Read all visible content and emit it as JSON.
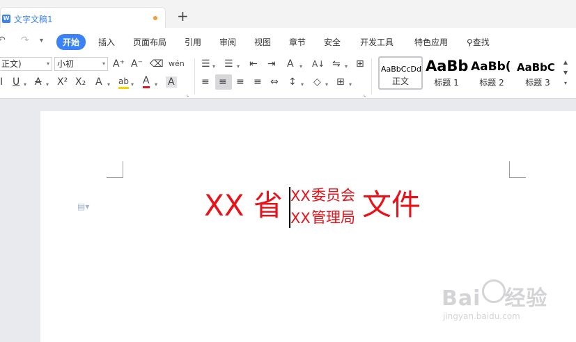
{
  "tabbar": {
    "doc_icon": "word-doc-icon",
    "doc_title": "文字文稿1",
    "new_tab": "+"
  },
  "menu": {
    "undo": "↶",
    "redo": "↷",
    "more": "▾",
    "items": [
      "开始",
      "插入",
      "页面布局",
      "引用",
      "审阅",
      "视图",
      "章节",
      "安全",
      "开发工具",
      "特色应用"
    ],
    "search_label": "查找",
    "accent_color": "#3b82f6"
  },
  "toolbar": {
    "font_name": "正文)",
    "font_size": "小初",
    "grow_font": "A⁺",
    "shrink_font": "A⁻",
    "clear_format": "⌫",
    "phonetic": "wén",
    "underline": "U",
    "strikethrough": "A",
    "superscript": "X²",
    "subscript": "X₂",
    "text_effect": "A",
    "highlight": "ab",
    "font_color": "A",
    "char_shading": "A",
    "bullets": "☰",
    "numbering": "☰",
    "decrease_indent": "⇤",
    "increase_indent": "⇥",
    "char_spacing": "A",
    "sort": "A↓",
    "tab_show": "⇋",
    "table": "⊞",
    "align_left": "≡",
    "align_center": "≡",
    "align_right": "≡",
    "justify": "≡",
    "distribute": "⇔",
    "line_spacing": "↕",
    "shading": "◇",
    "borders": "⊞",
    "dropdown": "▾"
  },
  "styles": {
    "items": [
      {
        "sample": "AaBbCcDd",
        "label": "正文"
      },
      {
        "sample": "AaBb",
        "label": "标题 1"
      },
      {
        "sample": "AaBb(",
        "label": "标题 2"
      },
      {
        "sample": "AaBbC",
        "label": "标题 3"
      }
    ],
    "scroll_up": "▲",
    "scroll_down": "▼",
    "more": "▾"
  },
  "document": {
    "province": "XX 省",
    "line1_xx": "XX",
    "line1_org": "委员会",
    "line2_xx": "XX",
    "line2_org": "管理局",
    "doc_word": "文件",
    "text_color": "#e8131a"
  },
  "watermark": {
    "brand": "Bai",
    "brand_tail": "经验",
    "url": "jingyan.baidu.com"
  }
}
